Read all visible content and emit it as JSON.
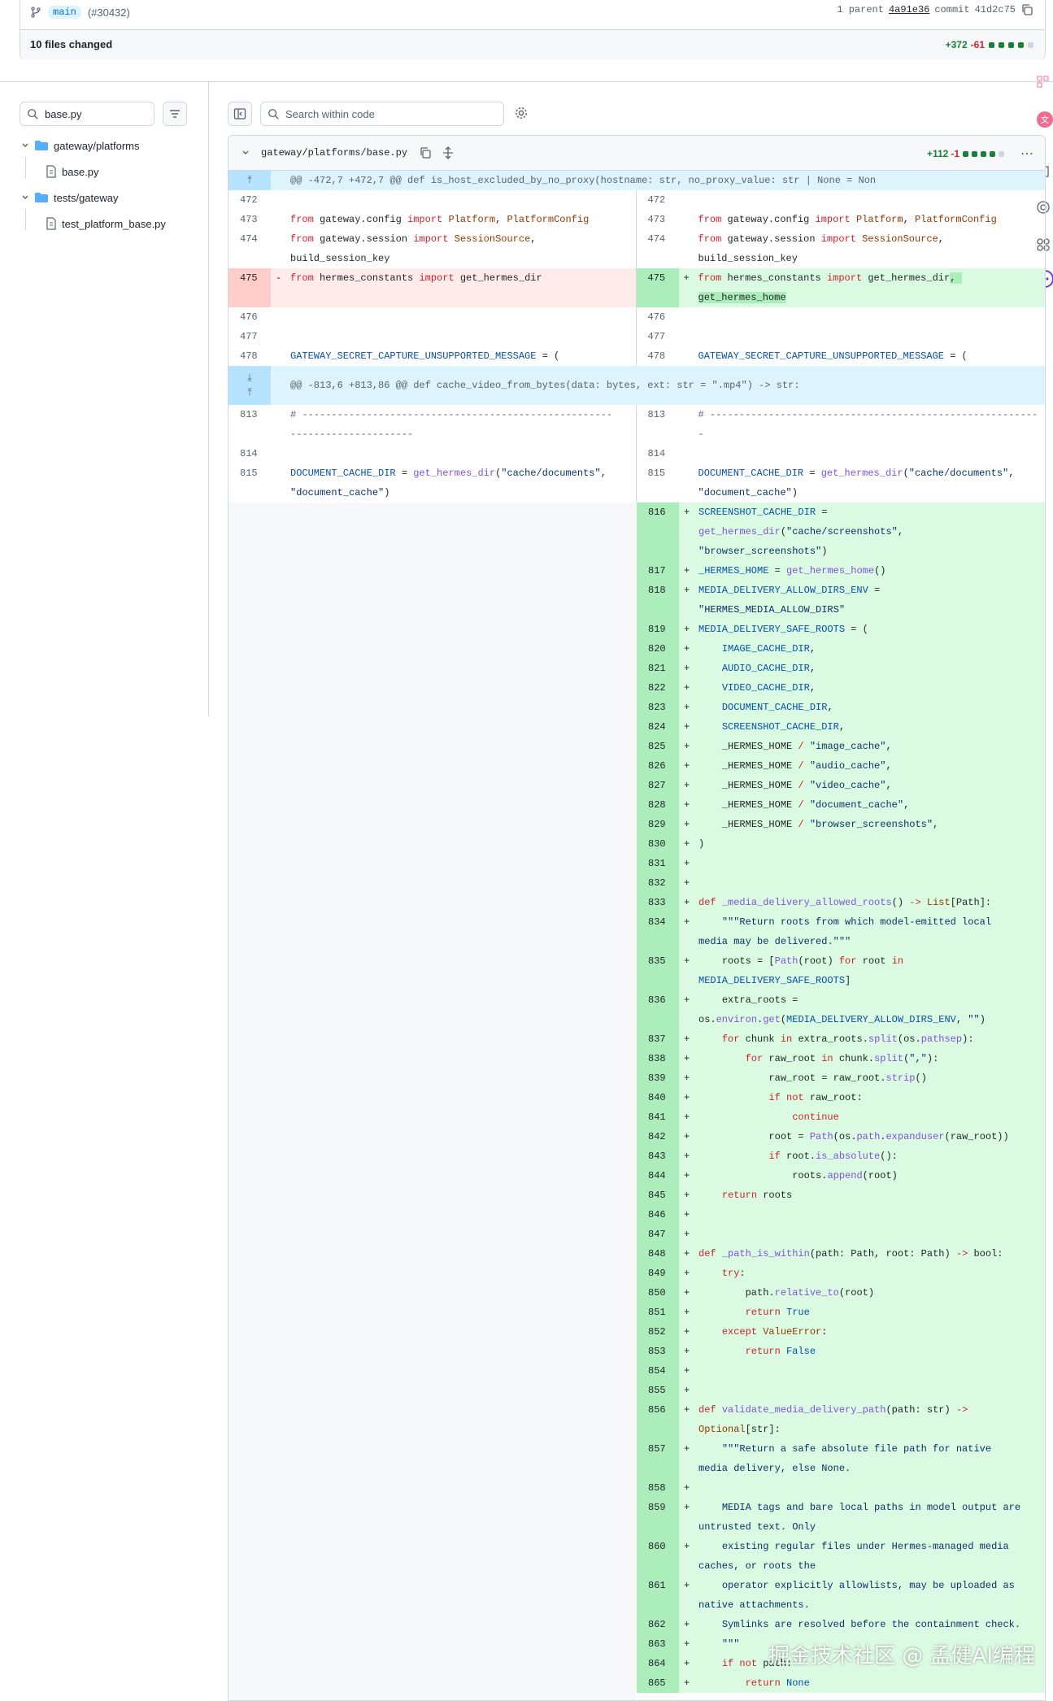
{
  "commit": {
    "branch": "main",
    "pr": "(#30432)",
    "parent_label": "1 parent",
    "parent_sha": "4a91e36",
    "commit_label": "commit",
    "commit_sha": "41d2c75",
    "files_changed": "10 files changed",
    "additions": "+372",
    "deletions": "-61"
  },
  "sidebar": {
    "filter_value": "base.py",
    "tree": [
      {
        "label": "gateway/platforms",
        "type": "folder"
      },
      {
        "label": "base.py",
        "type": "file"
      },
      {
        "label": "tests/gateway",
        "type": "folder"
      },
      {
        "label": "test_platform_base.py",
        "type": "file"
      }
    ]
  },
  "toolbar": {
    "search_placeholder": "Search within code"
  },
  "diff": {
    "path": "gateway/platforms/base.py",
    "additions": "+112",
    "deletions": "-1",
    "hunks": [
      "@@ -472,7 +472,7 @@ def is_host_excluded_by_no_proxy(hostname: str, no_proxy_value: str | None = Non",
      "@@ -813,6 +813,86 @@ def cache_video_from_bytes(data: bytes, ext: str = \".mp4\") -> str:"
    ]
  },
  "watermark": "掘金技术社区 @ 孟健AI编程",
  "colors": {
    "addition": "#1a7f37",
    "deletion": "#d1242f",
    "hunk_bg": "#ddf4ff",
    "add_bg": "#dafbe1",
    "del_bg": "#ffebe9"
  }
}
